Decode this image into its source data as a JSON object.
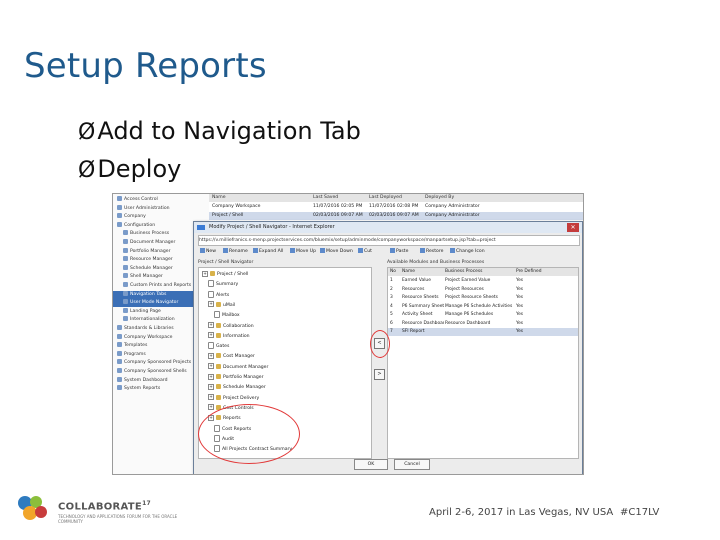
{
  "slide": {
    "title": "Setup Reports",
    "bullets": [
      "Add to Navigation Tab",
      "Deploy"
    ],
    "bullet_mark": "Ø"
  },
  "footer": {
    "logo_text": "COLLABORATE",
    "logo_sup": "17",
    "logo_sub": "TECHNOLOGY AND APPLICATIONS FORUM FOR THE ORACLE COMMUNITY",
    "event": "April 2-6, 2017 in Las Vegas, NV USA",
    "tag": "#C17LV"
  },
  "tree": {
    "items": [
      {
        "label": "Access Control",
        "selected": false
      },
      {
        "label": "User Administration",
        "selected": false
      },
      {
        "label": "Company",
        "selected": false
      },
      {
        "label": "Configuration",
        "selected": false
      },
      {
        "label": "Business Process",
        "selected": false
      },
      {
        "label": "Document Manager",
        "selected": false
      },
      {
        "label": "Portfolio Manager",
        "selected": false
      },
      {
        "label": "Resource Manager",
        "selected": false
      },
      {
        "label": "Schedule Manager",
        "selected": false
      },
      {
        "label": "Shell Manager",
        "selected": false
      },
      {
        "label": "Custom Prints and Reports",
        "selected": false
      },
      {
        "label": "Navigation Tabs",
        "selected": true
      },
      {
        "label": "User Mode Navigator",
        "selected": true
      },
      {
        "label": "Landing Page",
        "selected": false
      },
      {
        "label": "Internationalization",
        "selected": false
      },
      {
        "label": "Standards & Libraries",
        "selected": false
      },
      {
        "label": "Company Workspace",
        "selected": false
      },
      {
        "label": "Templates",
        "selected": false
      },
      {
        "label": "Programs",
        "selected": false
      },
      {
        "label": "Company Sponsored Projects",
        "selected": false
      },
      {
        "label": "Company Sponsored Shells",
        "selected": false
      },
      {
        "label": "System Dashboard",
        "selected": false
      },
      {
        "label": "System Reports",
        "selected": false
      }
    ]
  },
  "grid": {
    "headers": [
      "Name",
      "Last Saved",
      "Last Deployed",
      "Deployed By"
    ],
    "rows": [
      [
        "Company Workspace",
        "11/07/2016 02:05 PM",
        "11/07/2016 02:08 PM",
        "Company Administrator"
      ],
      [
        "Project / Shell",
        "02/03/2016 09:07 AM",
        "02/03/2016 09:07 AM",
        "Company Administrator"
      ]
    ]
  },
  "modal": {
    "title": "Modify Project / Shell Navigator - Internet Explorer",
    "close": "✕",
    "address": "https://v.milliefranics.s-menp.projectservices.com/bluemix/setup/adminmode/companyworkspace/manpartsetup.jsp?tab=project",
    "toolbar": [
      "New",
      "Rename",
      "Expand All",
      "Move Up",
      "Move Down",
      "Cut",
      "Paste",
      "Restore",
      "Change Icon"
    ],
    "left_label": "Project / Shell Navigator",
    "right_label": "Available Modules and Business Processes",
    "left_items": [
      {
        "label": "Project / Shell",
        "type": "folder"
      },
      {
        "label": "Summary",
        "type": "doc"
      },
      {
        "label": "Alerts",
        "type": "doc"
      },
      {
        "label": "uMail",
        "type": "folder"
      },
      {
        "label": "Mailbox",
        "type": "doc"
      },
      {
        "label": "Collaboration",
        "type": "folder"
      },
      {
        "label": "Information",
        "type": "folder"
      },
      {
        "label": "Gates",
        "type": "doc"
      },
      {
        "label": "Cost Manager",
        "type": "folder"
      },
      {
        "label": "Document Manager",
        "type": "folder"
      },
      {
        "label": "Portfolio Manager",
        "type": "folder"
      },
      {
        "label": "Schedule Manager",
        "type": "folder"
      },
      {
        "label": "Project Delivery",
        "type": "folder"
      },
      {
        "label": "Cost Controls",
        "type": "folder"
      },
      {
        "label": "Reports",
        "type": "folder"
      },
      {
        "label": "Cost Reports",
        "type": "doc"
      },
      {
        "label": "Audit",
        "type": "doc"
      },
      {
        "label": "All Projects Contract Summary",
        "type": "doc"
      }
    ],
    "right_headers": [
      "No",
      "Name",
      "Business Process",
      "Pre Defined"
    ],
    "right_rows": [
      [
        "1",
        "Earned Value",
        "Project Earned Value",
        "Yes"
      ],
      [
        "2",
        "Resources",
        "Project Resources",
        "Yes"
      ],
      [
        "3",
        "Resource Sheets",
        "Project Resource Sheets",
        "Yes"
      ],
      [
        "4",
        "P6 Summary Sheet",
        "Manage P6 Schedule Activities",
        "Yes"
      ],
      [
        "5",
        "Activity Sheet",
        "Manage P6 Schedules",
        "Yes"
      ],
      [
        "6",
        "Resource Dashboard",
        "Resource Dashboard",
        "Yes"
      ],
      [
        "7",
        "SFI Report",
        "",
        "Yes"
      ]
    ],
    "move_left": "<",
    "move_right": ">",
    "ok": "OK",
    "cancel": "Cancel"
  },
  "colors": {
    "title": "#1f5a8c",
    "selection": "#3b6fb6",
    "annotation": "#e23a3a"
  }
}
